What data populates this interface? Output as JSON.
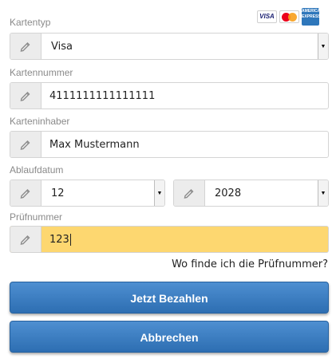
{
  "card_logos": {
    "visa": "VISA",
    "amex": "AMERICAN EXPRESS"
  },
  "card_type": {
    "label": "Kartentyp",
    "value": "Visa"
  },
  "card_number": {
    "label": "Kartennummer",
    "value": "4111111111111111"
  },
  "card_holder": {
    "label": "Karteninhaber",
    "value": "Max Mustermann"
  },
  "expiry": {
    "label": "Ablaufdatum",
    "month": "12",
    "year": "2028"
  },
  "cvc": {
    "label": "Prüfnummer",
    "value": "123",
    "highlight_color": "#fdd770"
  },
  "help_link": "Wo finde ich die Prüfnummer?",
  "buttons": {
    "pay": "Jetzt Bezahlen",
    "cancel": "Abbrechen",
    "color": "#3a7cc1"
  },
  "icons": {
    "field_addon": "pencil-icon",
    "select_arrow": "triangle-down-icon"
  }
}
